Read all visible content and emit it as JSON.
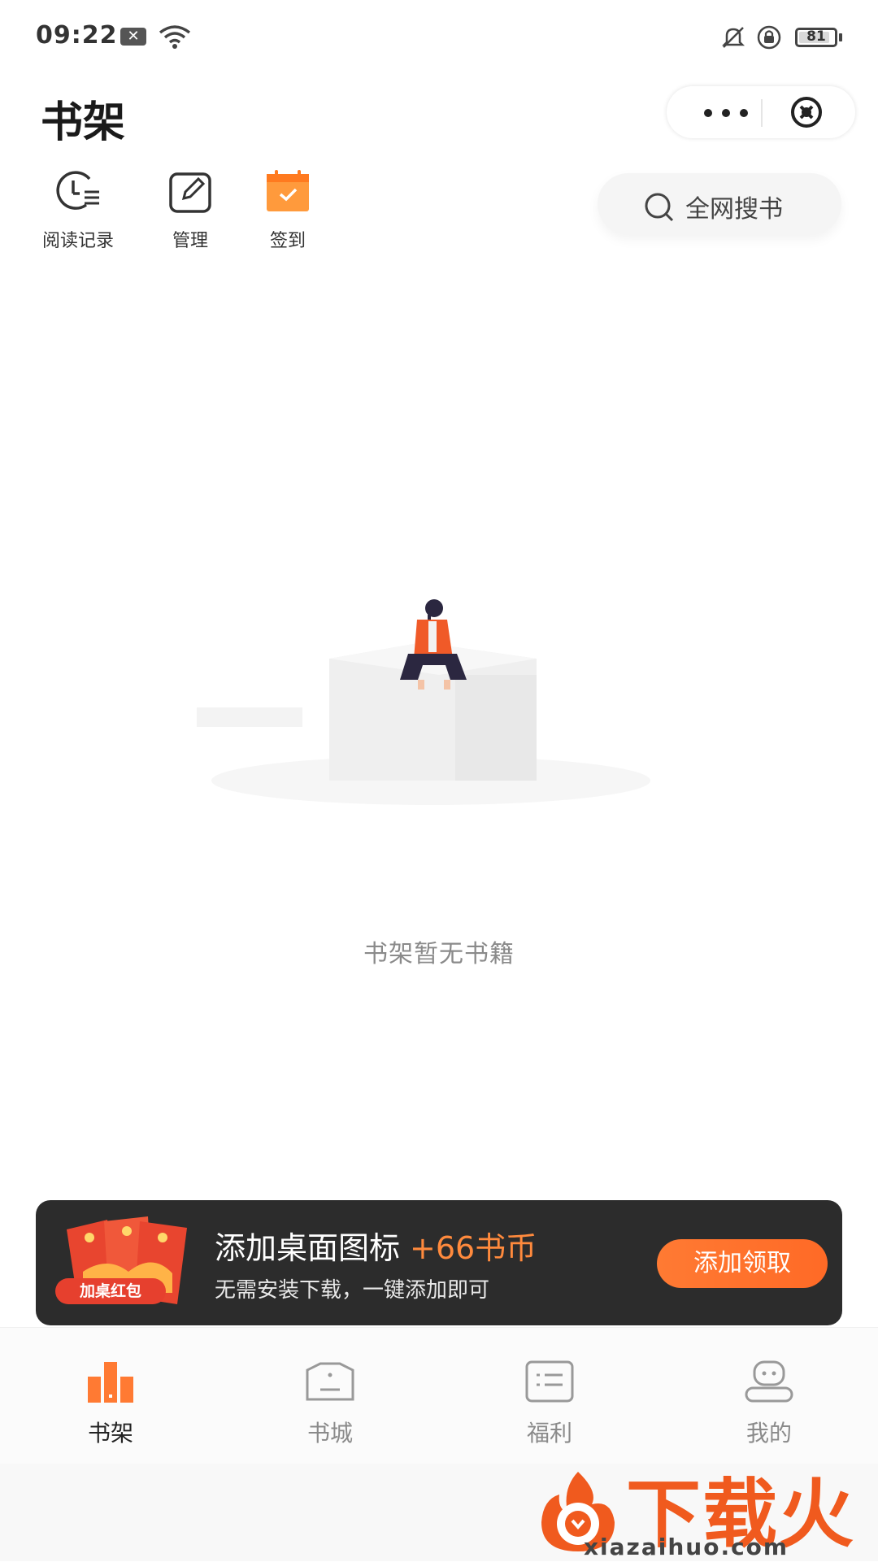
{
  "status_bar": {
    "time": "09:22",
    "battery": "81"
  },
  "header": {
    "title": "书架"
  },
  "toolbar": {
    "reading_history": "阅读记录",
    "manage": "管理",
    "checkin": "签到",
    "search": "全网搜书"
  },
  "empty_state": {
    "message": "书架暂无书籍"
  },
  "banner": {
    "title": "添加桌面图标",
    "coins": "+66书币",
    "subtitle": "无需安装下载，一键添加即可",
    "badge": "加桌红包",
    "button": "添加领取"
  },
  "tabs": [
    {
      "label": "书架",
      "active": true
    },
    {
      "label": "书城",
      "active": false
    },
    {
      "label": "福利",
      "active": false
    },
    {
      "label": "我的",
      "active": false
    }
  ],
  "watermark": {
    "text": "下载火",
    "url": "xiazaihuo.com"
  },
  "colors": {
    "accent": "#ff7a33",
    "banner_bg": "#2c2c2c",
    "active_tab": "#ff7a33"
  },
  "icons": [
    "close-icon",
    "wifi-icon",
    "bell-off-icon",
    "lock-rotation-icon",
    "battery-icon",
    "more-icon",
    "close-circle-icon",
    "clock-list-icon",
    "edit-icon",
    "calendar-check-icon",
    "search-icon",
    "red-packet-icon",
    "bookshelf-icon",
    "bookstore-icon",
    "welfare-icon",
    "profile-icon"
  ]
}
